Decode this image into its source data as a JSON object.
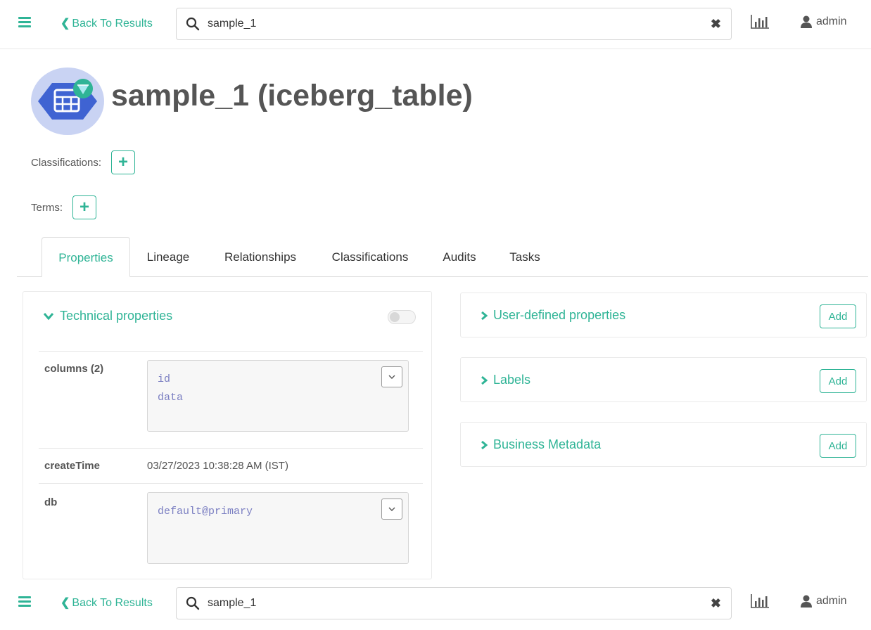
{
  "header": {
    "back_label": "Back To Results",
    "search_value": "sample_1",
    "user_name": "admin"
  },
  "entity": {
    "title": "sample_1 (iceberg_table)"
  },
  "classifications_label": "Classifications:",
  "terms_label": "Terms:",
  "tabs": [
    {
      "label": "Properties",
      "active": true
    },
    {
      "label": "Lineage"
    },
    {
      "label": "Relationships"
    },
    {
      "label": "Classifications"
    },
    {
      "label": "Audits"
    },
    {
      "label": "Tasks"
    }
  ],
  "technical_properties": {
    "title": "Technical properties",
    "rows": [
      {
        "key": "columns (2)",
        "values": [
          "id",
          "data"
        ]
      },
      {
        "key": "createTime",
        "value": "03/27/2023 10:38:28 AM (IST)"
      },
      {
        "key": "db",
        "values": [
          "default@primary"
        ]
      }
    ]
  },
  "side_panels": [
    {
      "title": "User-defined properties",
      "add_label": "Add"
    },
    {
      "title": "Labels",
      "add_label": "Add"
    },
    {
      "title": "Business Metadata",
      "add_label": "Add"
    }
  ],
  "colors": {
    "accent": "#2fb496",
    "entity_icon_bg": "#c9d3f3",
    "entity_icon_fg": "#3f63d2",
    "mono_value": "#7b7fc2"
  }
}
